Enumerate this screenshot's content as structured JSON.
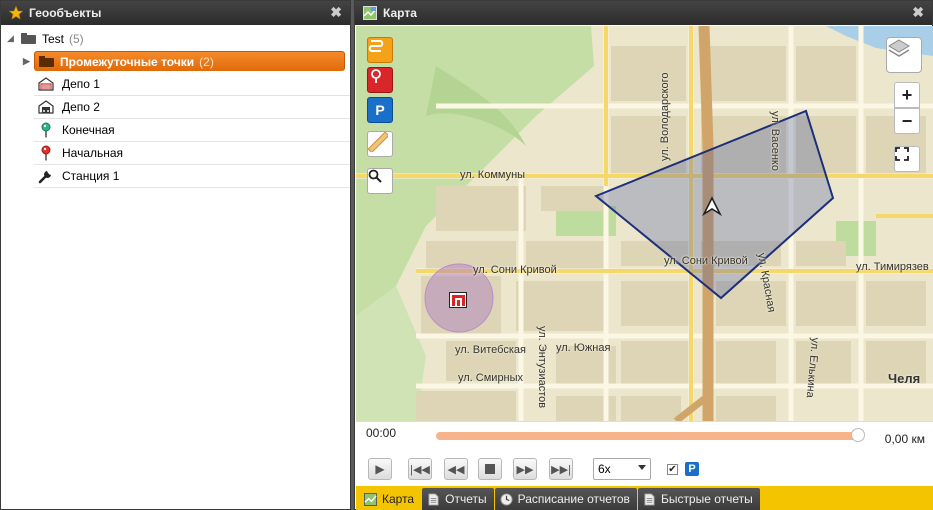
{
  "left_panel": {
    "title": "Геообъекты",
    "root": {
      "label": "Test",
      "count": "(5)"
    },
    "items": [
      {
        "label": "Промежуточные точки",
        "count": "(2)",
        "icon": "folder-icon",
        "selected": true
      },
      {
        "label": "Депо 1",
        "icon": "depot-icon"
      },
      {
        "label": "Депо 2",
        "icon": "garage-icon"
      },
      {
        "label": "Конечная",
        "icon": "pin-green-icon"
      },
      {
        "label": "Начальная",
        "icon": "pin-red-icon"
      },
      {
        "label": "Станция 1",
        "icon": "wrench-icon"
      }
    ]
  },
  "map_panel": {
    "title": "Карта",
    "streets": {
      "kommuny": "ул. Коммуны",
      "soni1": "ул. Сони Кривой",
      "soni2": "ул. Сони Кривой",
      "vitebskaya": "ул. Витебская",
      "smirnykh": "ул. Смирных",
      "yuzhnaya": "ул. Южная",
      "timiryazeva": "ул. Тимирязев",
      "volodarskogo": "ул. Володарского",
      "vasenko": "ул. Васенко",
      "krasnaya": "ул. Красная",
      "entuziastov": "ул. Энтузиастов",
      "elkina": "ул. Елькина",
      "city": "Челя"
    },
    "zoom_in": "+",
    "zoom_out": "−"
  },
  "player": {
    "time": "00:00",
    "distance": "0,00 км",
    "progress": 1.0,
    "speed": "6x",
    "parking_checked": true,
    "parking_label": "P"
  },
  "tabs": [
    {
      "label": "Карта",
      "active": true
    },
    {
      "label": "Отчеты"
    },
    {
      "label": "Расписание отчетов"
    },
    {
      "label": "Быстрые отчеты"
    }
  ],
  "colors": {
    "accent": "#f07a1a",
    "tabbar": "#f4c400",
    "geofence": "#1e2f7a"
  }
}
